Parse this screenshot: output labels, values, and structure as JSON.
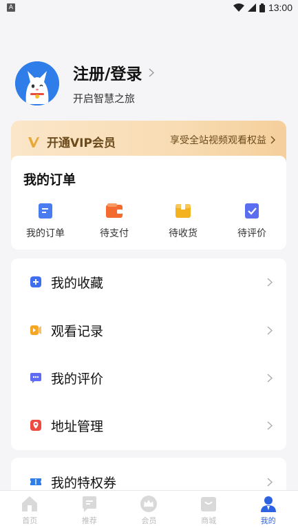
{
  "status": {
    "time": "13:00",
    "indicator": "A"
  },
  "profile": {
    "title": "注册/登录",
    "subtitle": "开启智慧之旅"
  },
  "vip": {
    "title": "开通VIP会员",
    "benefit": "享受全站视频观看权益"
  },
  "orders": {
    "title": "我的订单",
    "items": [
      {
        "label": "我的订单",
        "icon": "order-list-icon",
        "color": "#4a7cf0"
      },
      {
        "label": "待支付",
        "icon": "wallet-icon",
        "color": "#f36b2f"
      },
      {
        "label": "待收货",
        "icon": "package-icon",
        "color": "#f5b21f"
      },
      {
        "label": "待评价",
        "icon": "review-icon",
        "color": "#5b6ef0"
      }
    ]
  },
  "menu": [
    {
      "label": "我的收藏",
      "icon": "favorite-icon",
      "color": "#3f6ff0"
    },
    {
      "label": "观看记录",
      "icon": "history-icon",
      "color": "#f5a623"
    },
    {
      "label": "我的评价",
      "icon": "comment-icon",
      "color": "#5e6bf2"
    },
    {
      "label": "地址管理",
      "icon": "location-icon",
      "color": "#ef4a42"
    }
  ],
  "menu2": [
    {
      "label": "我的特权券",
      "icon": "coupon-icon",
      "color": "#2f7de8"
    }
  ],
  "tabs": [
    {
      "label": "首页",
      "icon": "home-icon",
      "active": false
    },
    {
      "label": "推荐",
      "icon": "recommend-icon",
      "active": false
    },
    {
      "label": "会员",
      "icon": "crown-icon",
      "active": false
    },
    {
      "label": "商城",
      "icon": "shop-icon",
      "active": false
    },
    {
      "label": "我的",
      "icon": "profile-icon",
      "active": true
    }
  ],
  "colors": {
    "accent": "#2d63e0",
    "vip_text": "#6b4a1c",
    "background": "#f5f5f7"
  }
}
